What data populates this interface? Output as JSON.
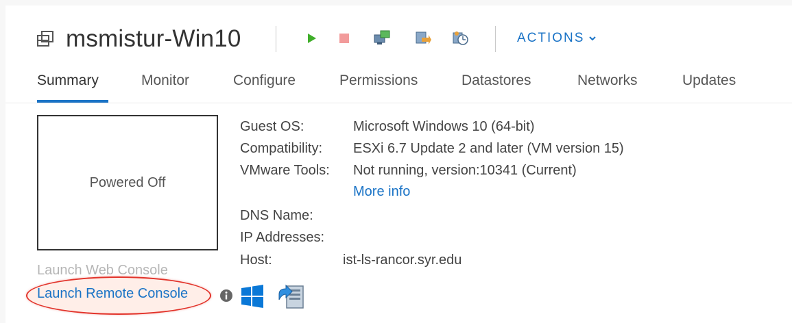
{
  "header": {
    "vm_icon": "vm-icon",
    "title": "msmistur-Win10",
    "toolbar_icons": [
      "power-on-icon",
      "power-off-icon",
      "launch-console-icon",
      "migrate-icon",
      "snapshot-icon"
    ],
    "actions_label": "ACTIONS"
  },
  "tabs": [
    {
      "label": "Summary",
      "active": true
    },
    {
      "label": "Monitor",
      "active": false
    },
    {
      "label": "Configure",
      "active": false
    },
    {
      "label": "Permissions",
      "active": false
    },
    {
      "label": "Datastores",
      "active": false
    },
    {
      "label": "Networks",
      "active": false
    },
    {
      "label": "Updates",
      "active": false
    }
  ],
  "console": {
    "status": "Powered Off",
    "web_console_label": "Launch Web Console",
    "remote_console_label": "Launch Remote Console",
    "icons": [
      "info-icon",
      "windows-icon",
      "remote-console-icon"
    ]
  },
  "details": {
    "guest_os": {
      "label": "Guest OS:",
      "value": "Microsoft Windows 10 (64-bit)"
    },
    "compatibility": {
      "label": "Compatibility:",
      "value": "ESXi 6.7 Update 2 and later (VM version 15)"
    },
    "vmware_tools": {
      "label": "VMware Tools:",
      "value": "Not running, version:10341 (Current)"
    },
    "more_info": "More info",
    "dns_name": {
      "label": "DNS Name:",
      "value": ""
    },
    "ip_addresses": {
      "label": "IP Addresses:",
      "value": ""
    },
    "host": {
      "label": "Host:",
      "value": "ist-ls-rancor.syr.edu"
    }
  },
  "colors": {
    "accent": "#1a73c6",
    "power_on": "#3fae29",
    "power_off": "#f29b9b",
    "highlight_oval": "#e2332a"
  }
}
